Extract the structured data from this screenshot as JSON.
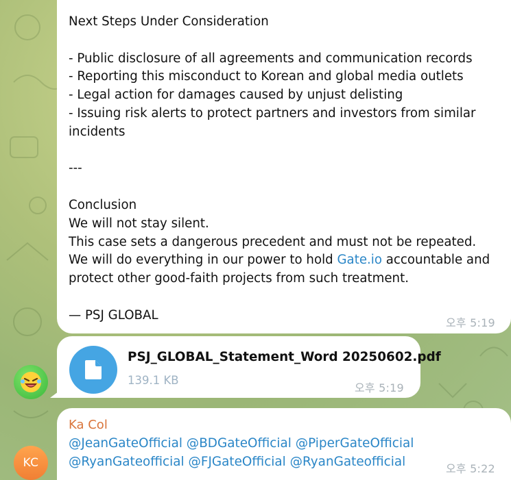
{
  "messages": {
    "statement": {
      "text": "Next Steps Under Consideration\n\n- Public disclosure of all agreements and communication records\n- Reporting this misconduct to Korean and global media outlets\n- Legal action for damages caused by unjust delisting\n- Issuing risk alerts to protect partners and investors from similar incidents\n\n---\n\nConclusion\nWe will not stay silent.\nThis case sets a dangerous precedent and must not be repeated.\nWe will do everything in our power to hold ",
      "link": "Gate.io",
      "text_after": " accountable and protect other good-faith projects from such treatment.\n\n— PSJ GLOBAL",
      "time": "오후 5:19"
    },
    "file": {
      "name": "PSJ_GLOBAL_Statement_Word 20250602.pdf",
      "size": "139.1 KB",
      "time": "오후 5:19",
      "icon": "document-icon"
    },
    "reply": {
      "sender": "Ka Col",
      "mentions": "@JeanGateOfficial @BDGateOfficial @PiperGateOfficial @RyanGateofficial @FJGateOfficial @RyanGateofficial",
      "time": "오후 5:22",
      "avatar_initials": "KC"
    }
  },
  "colors": {
    "link": "#2a86c7",
    "sender": "#d9743a",
    "file_icon_bg": "#45a5e3",
    "avatar_kc": "#f4873a",
    "avatar_sticker": "#4fc84a"
  }
}
